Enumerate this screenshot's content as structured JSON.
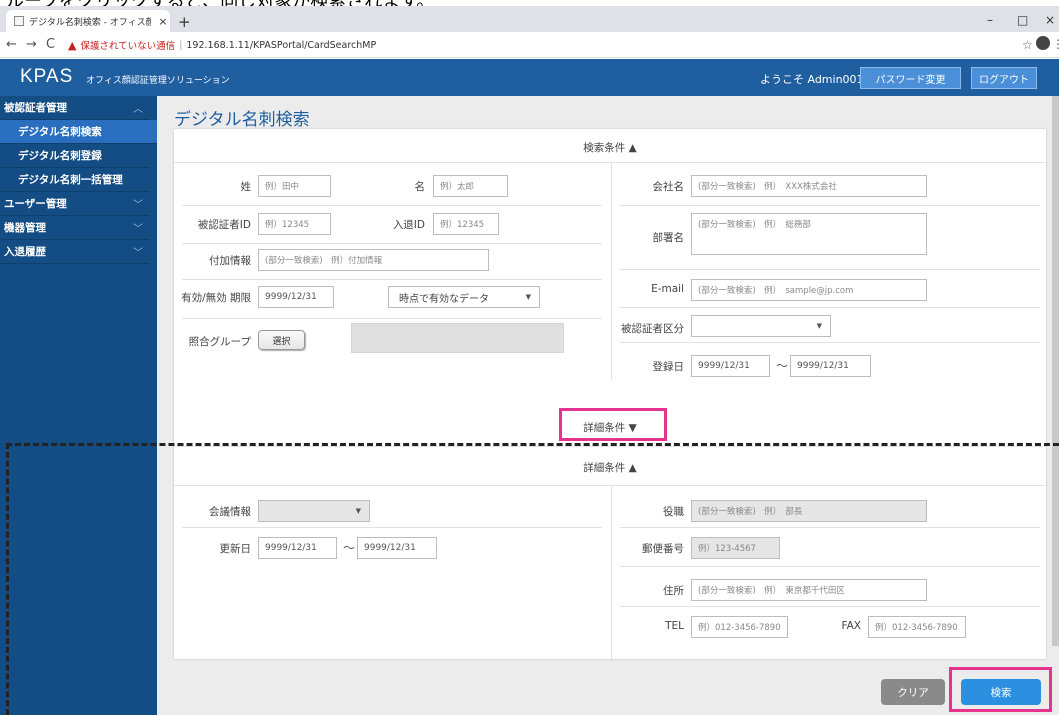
{
  "browser": {
    "tab_title": "デジタル名刺検索 - オフィス顔認証ソ",
    "tab_close": "×",
    "new_tab": "+",
    "window_controls": [
      "–",
      "□",
      "×"
    ],
    "nav_back": "←",
    "nav_forward": "→",
    "nav_reload": "C",
    "security_warning": "保護されていない通信",
    "separator": "|",
    "url": "192.168.1.11/KPASPortal/CardSearchMP"
  },
  "header": {
    "logo": "KPAS",
    "logo_sub": "オフィス顔認証管理ソリューション",
    "welcome": "ようこそ Admin001さん",
    "password_button": "パスワード変更",
    "logout_button": "ログアウト"
  },
  "sidebar": {
    "items": [
      {
        "label": "被認証者管理",
        "chev": "︿"
      },
      {
        "label": "デジタル名刺検索"
      },
      {
        "label": "デジタル名刺登録"
      },
      {
        "label": "デジタル名刺一括管理"
      },
      {
        "label": "ユーザー管理",
        "chev": "﹀"
      },
      {
        "label": "機器管理",
        "chev": "﹀"
      },
      {
        "label": "入退履歴",
        "chev": "﹀"
      }
    ]
  },
  "main": {
    "title": "デジタル名刺検索",
    "search_header": "検索条件 ▲",
    "detail_toggle": "詳細条件 ▼",
    "detail_header": "詳細条件 ▲",
    "fields": {
      "sei_label": "姓",
      "sei_placeholder": "例）田中",
      "mei_label": "名",
      "mei_placeholder": "例）太郎",
      "company_label": "会社名",
      "company_placeholder": "(部分一致検索)　例）　XXX株式会社",
      "auth_id_label": "被認証者ID",
      "auth_id_placeholder": "例）12345",
      "entry_id_label": "入退ID",
      "entry_id_placeholder": "例）12345",
      "dept_label": "部署名",
      "dept_placeholder": "(部分一致検索)　例）　総務部",
      "extra_label": "付加情報",
      "extra_placeholder": "(部分一致検索)　例）付加情報",
      "valid_label": "有効/無効 期限",
      "valid_value": "9999/12/31",
      "valid_select": "時点で有効なデータ",
      "email_label": "E-mail",
      "email_placeholder": "(部分一致検索)　例）　sample@jp.com",
      "auth_type_label": "被認証者区分",
      "group_label": "照合グループ",
      "group_button": "選択",
      "reg_date_label": "登録日",
      "reg_date_from": "9999/12/31",
      "reg_date_to": "9999/12/31",
      "meeting_label": "会議情報",
      "title_label": "役職",
      "title_placeholder": "(部分一致検索)　例）　部長",
      "update_label": "更新日",
      "update_from": "9999/12/31",
      "update_to": "9999/12/31",
      "zip_label": "郵便番号",
      "zip_placeholder": "例）123-4567",
      "address_label": "住所",
      "address_placeholder": "(部分一致検索)　例）　東京都千代田区",
      "tel_label": "TEL",
      "tel_placeholder": "例）012-3456-7890",
      "fax_label": "FAX",
      "fax_placeholder": "例）012-3456-7890",
      "tilde": "～"
    },
    "clear_button": "クリア",
    "search_button": "検索"
  },
  "colors": {
    "header_bg": "#1f5e9f",
    "sidebar_bg": "#134d84",
    "highlight": "#e6338e",
    "search_button": "#2d8fe0"
  }
}
